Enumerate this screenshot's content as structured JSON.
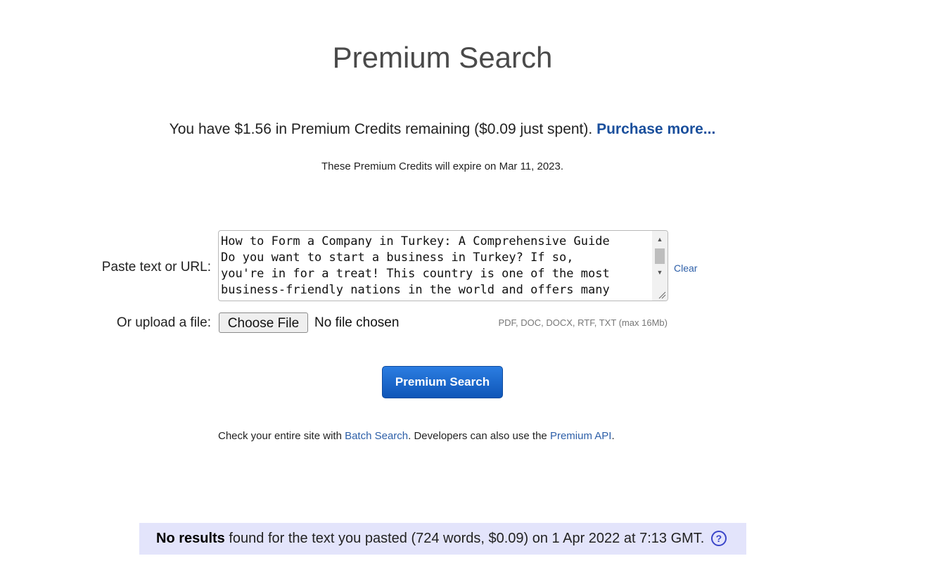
{
  "page": {
    "title": "Premium Search"
  },
  "credits": {
    "prefix": "You have $1.56 in Premium Credits remaining ($0.09 just spent).",
    "purchase_link": "Purchase more...",
    "expire_text": "These Premium Credits will expire on Mar 11, 2023."
  },
  "form": {
    "paste_label": "Paste text or URL:",
    "textarea_value": "How to Form a Company in Turkey: A Comprehensive Guide\nDo you want to start a business in Turkey? If so,\nyou're in for a treat! This country is one of the most\nbusiness-friendly nations in the world and offers many",
    "clear_link": "Clear",
    "upload_label": "Or upload a file:",
    "choose_file_button": "Choose File",
    "file_status": "No file chosen",
    "file_types": "PDF, DOC, DOCX, RTF, TXT (max 16Mb)",
    "search_button": "Premium Search"
  },
  "footer_links": {
    "prefix": "Check your entire site with",
    "batch_link": "Batch Search",
    "middle": ". Developers can also use the",
    "api_link": "Premium API",
    "suffix": "."
  },
  "result": {
    "bold": "No results",
    "text": "found for the text you pasted (724 words, $0.09) on 1 Apr 2022 at 7:13 GMT.",
    "help_icon": "question-circle-icon"
  }
}
